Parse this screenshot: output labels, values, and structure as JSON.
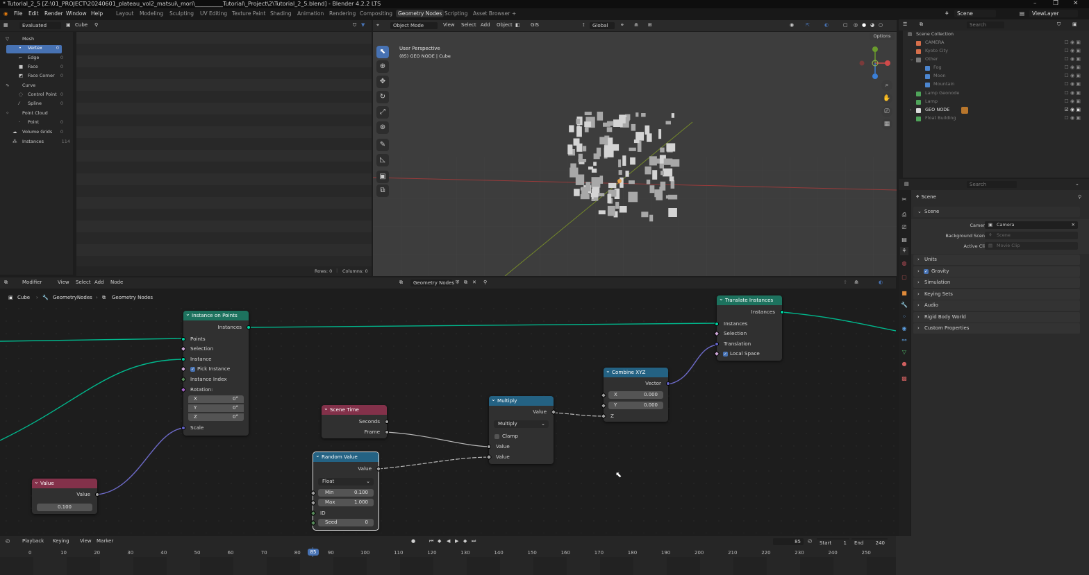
{
  "title": "* Tutorial_2_5 [Z:\\01_PROJECT\\20240601_plateau_vol2_matsui\\_mori\\__________Tutorial\\_Project\\2\\Tutorial_2_5.blend] - Blender 4.2.2 LTS",
  "menu": [
    "File",
    "Edit",
    "Render",
    "Window",
    "Help"
  ],
  "workspaces": [
    "Layout",
    "Modeling",
    "Sculpting",
    "UV Editing",
    "Texture Paint",
    "Shading",
    "Animation",
    "Rendering",
    "Compositing",
    "Geometry Nodes",
    "Scripting",
    "Asset Browser"
  ],
  "scene_selector": "Scene",
  "view_layer": "ViewLayer",
  "spreadsheet": {
    "mode": "Evaluated",
    "object": "Cube",
    "rows": "Rows: 0",
    "columns": "Columns: 0",
    "tree": [
      {
        "label": "Mesh"
      },
      {
        "label": "Vertex",
        "count": "0"
      },
      {
        "label": "Edge",
        "count": "0"
      },
      {
        "label": "Face",
        "count": "0"
      },
      {
        "label": "Face Corner",
        "count": "0"
      },
      {
        "label": "Curve"
      },
      {
        "label": "Control Point",
        "count": "0"
      },
      {
        "label": "Spline",
        "count": "0"
      },
      {
        "label": "Point Cloud"
      },
      {
        "label": "Point",
        "count": "0"
      },
      {
        "label": "Volume Grids",
        "count": "0"
      },
      {
        "label": "Instances",
        "count": "114"
      }
    ]
  },
  "viewport": {
    "mode": "Object Mode",
    "menus": [
      "View",
      "Select",
      "Add",
      "Object",
      "GIS"
    ],
    "orientation": "Global",
    "options": "Options",
    "info1": "User Perspective",
    "info2": "(85) GEO NODE | Cube"
  },
  "outliner": {
    "search": "Search",
    "items": [
      {
        "label": "Scene Collection"
      },
      {
        "label": "CAMERA"
      },
      {
        "label": "Kyoto City"
      },
      {
        "label": "Other"
      },
      {
        "label": "Fog"
      },
      {
        "label": "Moon"
      },
      {
        "label": "Mountain"
      },
      {
        "label": "Lamp Geonode"
      },
      {
        "label": "Lamp"
      },
      {
        "label": "GEO NODE"
      },
      {
        "label": "Float Building"
      }
    ]
  },
  "properties": {
    "search": "Search",
    "scene": "Scene",
    "section": "Scene",
    "camera_label": "Camera",
    "camera_value": "Camera",
    "bg_label": "Background Scene",
    "bg_value": "Scene",
    "clip_label": "Active Clip",
    "clip_value": "Movie Clip",
    "panels": [
      "Units",
      "Gravity",
      "Simulation",
      "Keying Sets",
      "Audio",
      "Rigid Body World",
      "Custom Properties"
    ]
  },
  "node_editor": {
    "header": [
      "Modifier",
      "View",
      "Select",
      "Add",
      "Node"
    ],
    "tree_name": "Geometry Nodes",
    "breadcrumb": [
      "Cube",
      "GeometryNodes",
      "Geometry Nodes"
    ],
    "instance_on_points": {
      "title": "Instance on Points",
      "out": "Instances",
      "inputs": [
        "Points",
        "Selection",
        "Instance",
        "Pick Instance",
        "Instance Index",
        "Rotation:",
        "Scale"
      ],
      "rx": "X",
      "rxv": "0°",
      "ry": "Y",
      "ryv": "0°",
      "rz": "Z",
      "rzv": "0°"
    },
    "translate": {
      "title": "Translate Instances",
      "out": "Instances",
      "inputs": [
        "Instances",
        "Selection",
        "Translation",
        "Local Space"
      ]
    },
    "combine": {
      "title": "Combine XYZ",
      "out": "Vector",
      "x": "X",
      "xv": "0.000",
      "y": "Y",
      "yv": "0.000",
      "z": "Z"
    },
    "multiply": {
      "title": "Multiply",
      "out": "Value",
      "op": "Multiply",
      "clamp": "Clamp",
      "in1": "Value",
      "in2": "Value"
    },
    "scene_time": {
      "title": "Scene Time",
      "seconds": "Seconds",
      "frame": "Frame"
    },
    "random": {
      "title": "Random Value",
      "out": "Value",
      "type": "Float",
      "min": "Min",
      "minv": "0.100",
      "max": "Max",
      "maxv": "1.000",
      "id": "ID",
      "seed": "Seed",
      "seedv": "0"
    },
    "value": {
      "title": "Value",
      "out": "Value",
      "val": "0.100"
    }
  },
  "timeline": {
    "menus": [
      "Playback",
      "Keying",
      "View",
      "Marker"
    ],
    "current": "85",
    "start_label": "Start",
    "start": "1",
    "end_label": "End",
    "end": "240",
    "ticks": [
      "0",
      "10",
      "20",
      "30",
      "40",
      "50",
      "60",
      "70",
      "80",
      "90",
      "100",
      "110",
      "120",
      "130",
      "140",
      "150",
      "160",
      "170",
      "180",
      "190",
      "200",
      "210",
      "220",
      "230",
      "240",
      "250"
    ]
  }
}
